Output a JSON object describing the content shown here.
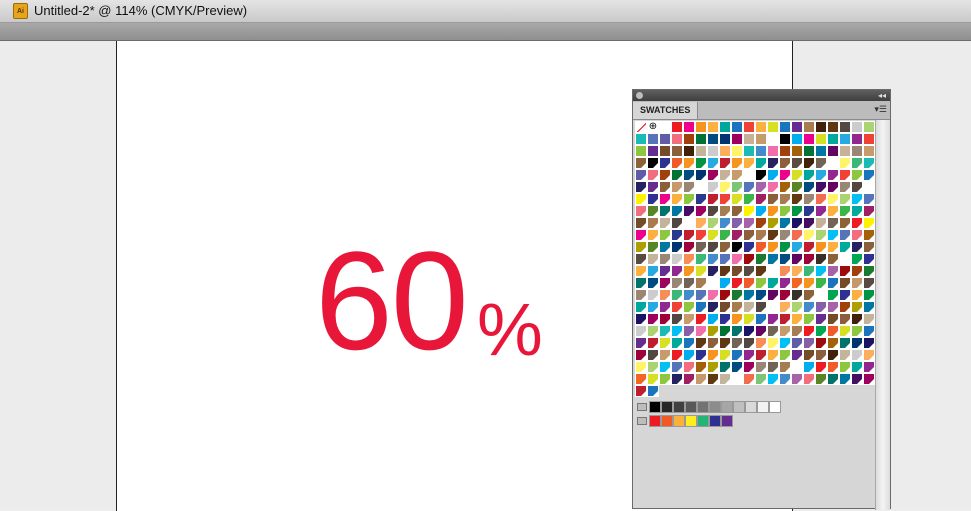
{
  "window": {
    "title": "Untitled-2* @ 114% (CMYK/Preview)",
    "app_icon": "illustrator-doc-icon",
    "app_icon_text": "Ai"
  },
  "artboard": {
    "number": "60",
    "percent": "%",
    "accent_color": "#e8173a"
  },
  "swatches_panel": {
    "tab_label": "SWATCHES",
    "menu_icon": "panel-menu-icon",
    "collapse_icon": "double-chevron-icon",
    "grid_columns": 20,
    "grid_rows": 22,
    "first_row_colors": [
      "#ffffff",
      "#000000",
      "#ed1c24",
      "#fff200",
      "#00a651",
      "#00aeef",
      "#2e3192",
      "#ec008c",
      "#ed1c24",
      "#f15a29",
      "#f7941d",
      "#fbb040",
      "#d7df23",
      "#8dc63f"
    ],
    "second_row_colors": [
      "#009444",
      "#00a79d",
      "#27aae1",
      "#1c75bc",
      "#2b388f",
      "#662d91",
      "#92278f",
      "#be1e2d",
      "#ef4136",
      "#f26522",
      "#f7941d",
      "#fcb040",
      "#d8e023",
      "#8dc63f",
      "#39b54a",
      "#00a99d",
      "#1b75bc",
      "#262262",
      "#662d91",
      "#9e1f63"
    ],
    "third_row_colors": [
      "#603813",
      "#754c29",
      "#8b5e3c",
      "#a97c50",
      "#c49a6c",
      "#594a42",
      "#42210b",
      "#603913",
      "#c2b59b",
      "#998675",
      "#736357",
      "#534741",
      "#ffffff",
      "#cccccc"
    ],
    "gray_group": [
      "#000000",
      "#262626",
      "#404040",
      "#595959",
      "#737373",
      "#8c8c8c",
      "#a6a6a6",
      "#bfbfbf",
      "#d9d9d9",
      "#f2f2f2",
      "#ffffff"
    ],
    "bright_group": [
      "#ed1c24",
      "#f15a24",
      "#fbb03b",
      "#fcee21",
      "#22b573",
      "#2e3192",
      "#662d91"
    ]
  }
}
